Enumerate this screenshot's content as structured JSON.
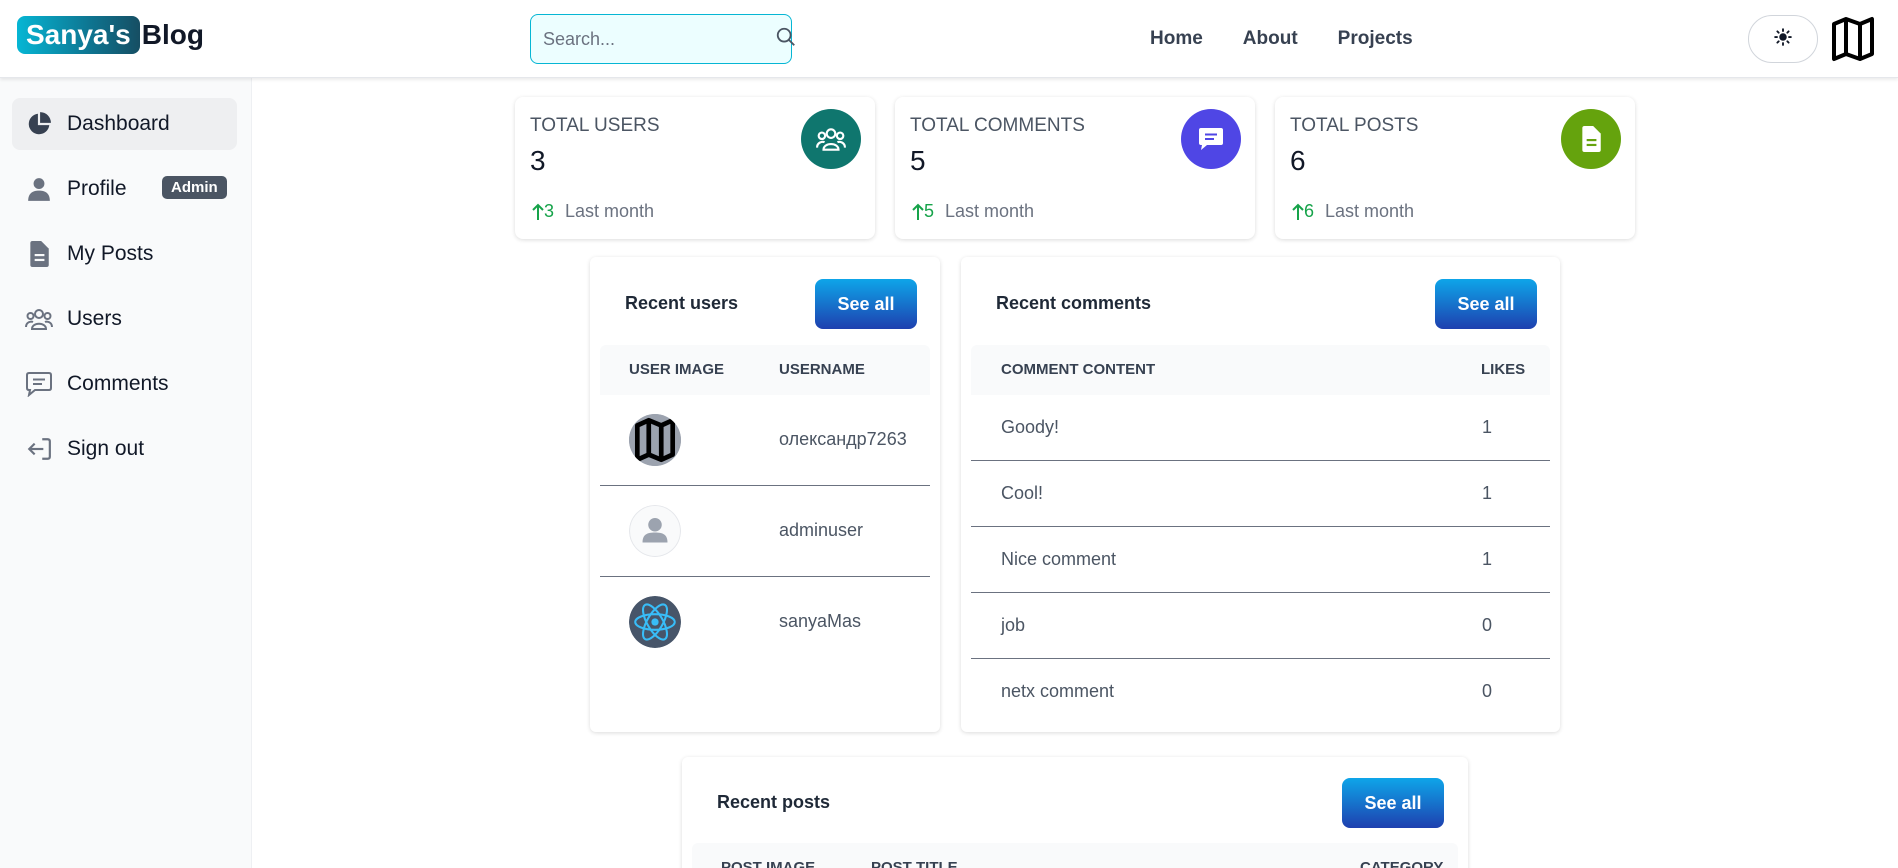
{
  "header": {
    "logo_badge": "Sanya's",
    "logo_text": "Blog",
    "search_placeholder": "Search...",
    "nav": [
      "Home",
      "About",
      "Projects"
    ],
    "theme_icon": "sun-icon",
    "avatar_icon": "map-icon"
  },
  "sidebar": {
    "items": [
      {
        "label": "Dashboard",
        "icon": "pie-chart-icon"
      },
      {
        "label": "Profile",
        "icon": "user-icon",
        "badge": "Admin"
      },
      {
        "label": "My Posts",
        "icon": "document-icon"
      },
      {
        "label": "Users",
        "icon": "users-icon"
      },
      {
        "label": "Comments",
        "icon": "comment-icon"
      },
      {
        "label": "Sign out",
        "icon": "sign-out-icon"
      }
    ]
  },
  "stats": [
    {
      "title": "TOTAL USERS",
      "value": "3",
      "delta": "3",
      "period": "Last month",
      "color": "#0f766e",
      "icon": "users-icon"
    },
    {
      "title": "TOTAL COMMENTS",
      "value": "5",
      "delta": "5",
      "period": "Last month",
      "color": "#4f46e5",
      "icon": "comment-icon"
    },
    {
      "title": "TOTAL POSTS",
      "value": "6",
      "delta": "6",
      "period": "Last month",
      "color": "#65a30d",
      "icon": "document-icon"
    }
  ],
  "recent_users": {
    "title": "Recent users",
    "button": "See all",
    "columns": [
      "USER IMAGE",
      "USERNAME"
    ],
    "rows": [
      {
        "username": "олександр7263",
        "image_icon": "map-avatar-icon"
      },
      {
        "username": "adminuser",
        "image_icon": "default-avatar-icon"
      },
      {
        "username": "sanyaMas",
        "image_icon": "react-logo-icon"
      }
    ]
  },
  "recent_comments": {
    "title": "Recent comments",
    "button": "See all",
    "columns": [
      "COMMENT CONTENT",
      "LIKES"
    ],
    "rows": [
      {
        "content": "Goody!",
        "likes": "1"
      },
      {
        "content": "Cool!",
        "likes": "1"
      },
      {
        "content": "Nice comment",
        "likes": "1"
      },
      {
        "content": "job",
        "likes": "0"
      },
      {
        "content": "netx comment",
        "likes": "0"
      }
    ]
  },
  "recent_posts": {
    "title": "Recent posts",
    "button": "See all",
    "columns": [
      "POST IMAGE",
      "POST TITLE",
      "CATEGORY"
    ]
  },
  "colors": {
    "accent": "#06b6d4",
    "button_top": "#0ea5e9",
    "button_bottom": "#1e40af",
    "up_arrow": "#16a34a"
  }
}
